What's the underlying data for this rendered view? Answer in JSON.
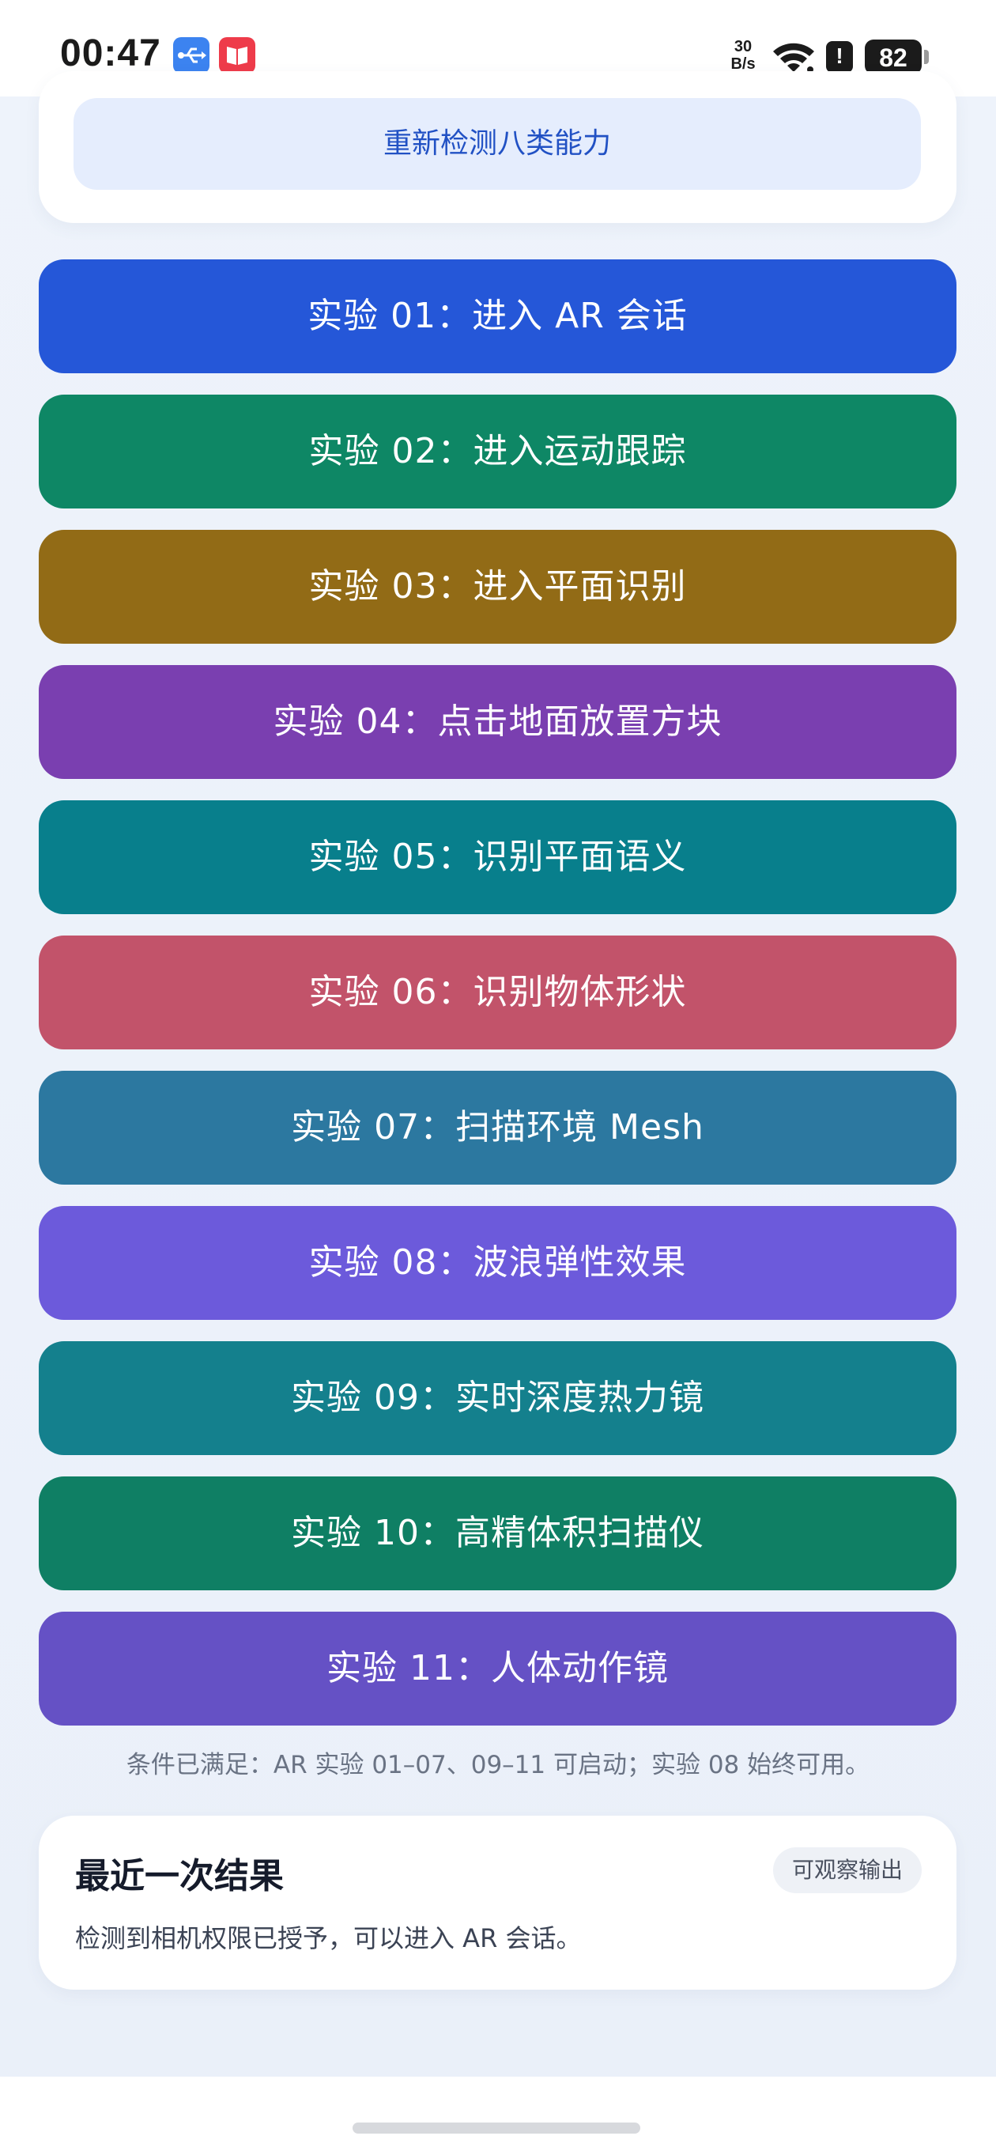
{
  "status_bar": {
    "time": "00:47",
    "net_speed_value": "30",
    "net_speed_unit": "B/s",
    "battery": "82",
    "alert_glyph": "!",
    "icons": [
      "usb-icon",
      "book-icon",
      "wifi-icon",
      "alert-icon",
      "battery-icon"
    ]
  },
  "top_card": {
    "recheck_label": "重新检测八类能力"
  },
  "experiments": [
    {
      "label": "实验 01：进入 AR 会话",
      "color": "#2557d8"
    },
    {
      "label": "实验 02：进入运动跟踪",
      "color": "#0e8765"
    },
    {
      "label": "实验 03：进入平面识别",
      "color": "#926b16"
    },
    {
      "label": "实验 04：点击地面放置方块",
      "color": "#7a3fb0"
    },
    {
      "label": "实验 05：识别平面语义",
      "color": "#087f8c"
    },
    {
      "label": "实验 06：识别物体形状",
      "color": "#c2536a"
    },
    {
      "label": "实验 07：扫描环境 Mesh",
      "color": "#2c78a0"
    },
    {
      "label": "实验 08：波浪弹性效果",
      "color": "#6c5adb"
    },
    {
      "label": "实验 09：实时深度热力镜",
      "color": "#14808d"
    },
    {
      "label": "实验 10：高精体积扫描仪",
      "color": "#0f7f64"
    },
    {
      "label": "实验 11：人体动作镜",
      "color": "#6551c5"
    }
  ],
  "condition_note": "条件已满足：AR 实验 01–07、09–11 可启动；实验 08 始终可用。",
  "result": {
    "title": "最近一次结果",
    "badge": "可观察输出",
    "text": "检测到相机权限已授予，可以进入 AR 会话。"
  }
}
